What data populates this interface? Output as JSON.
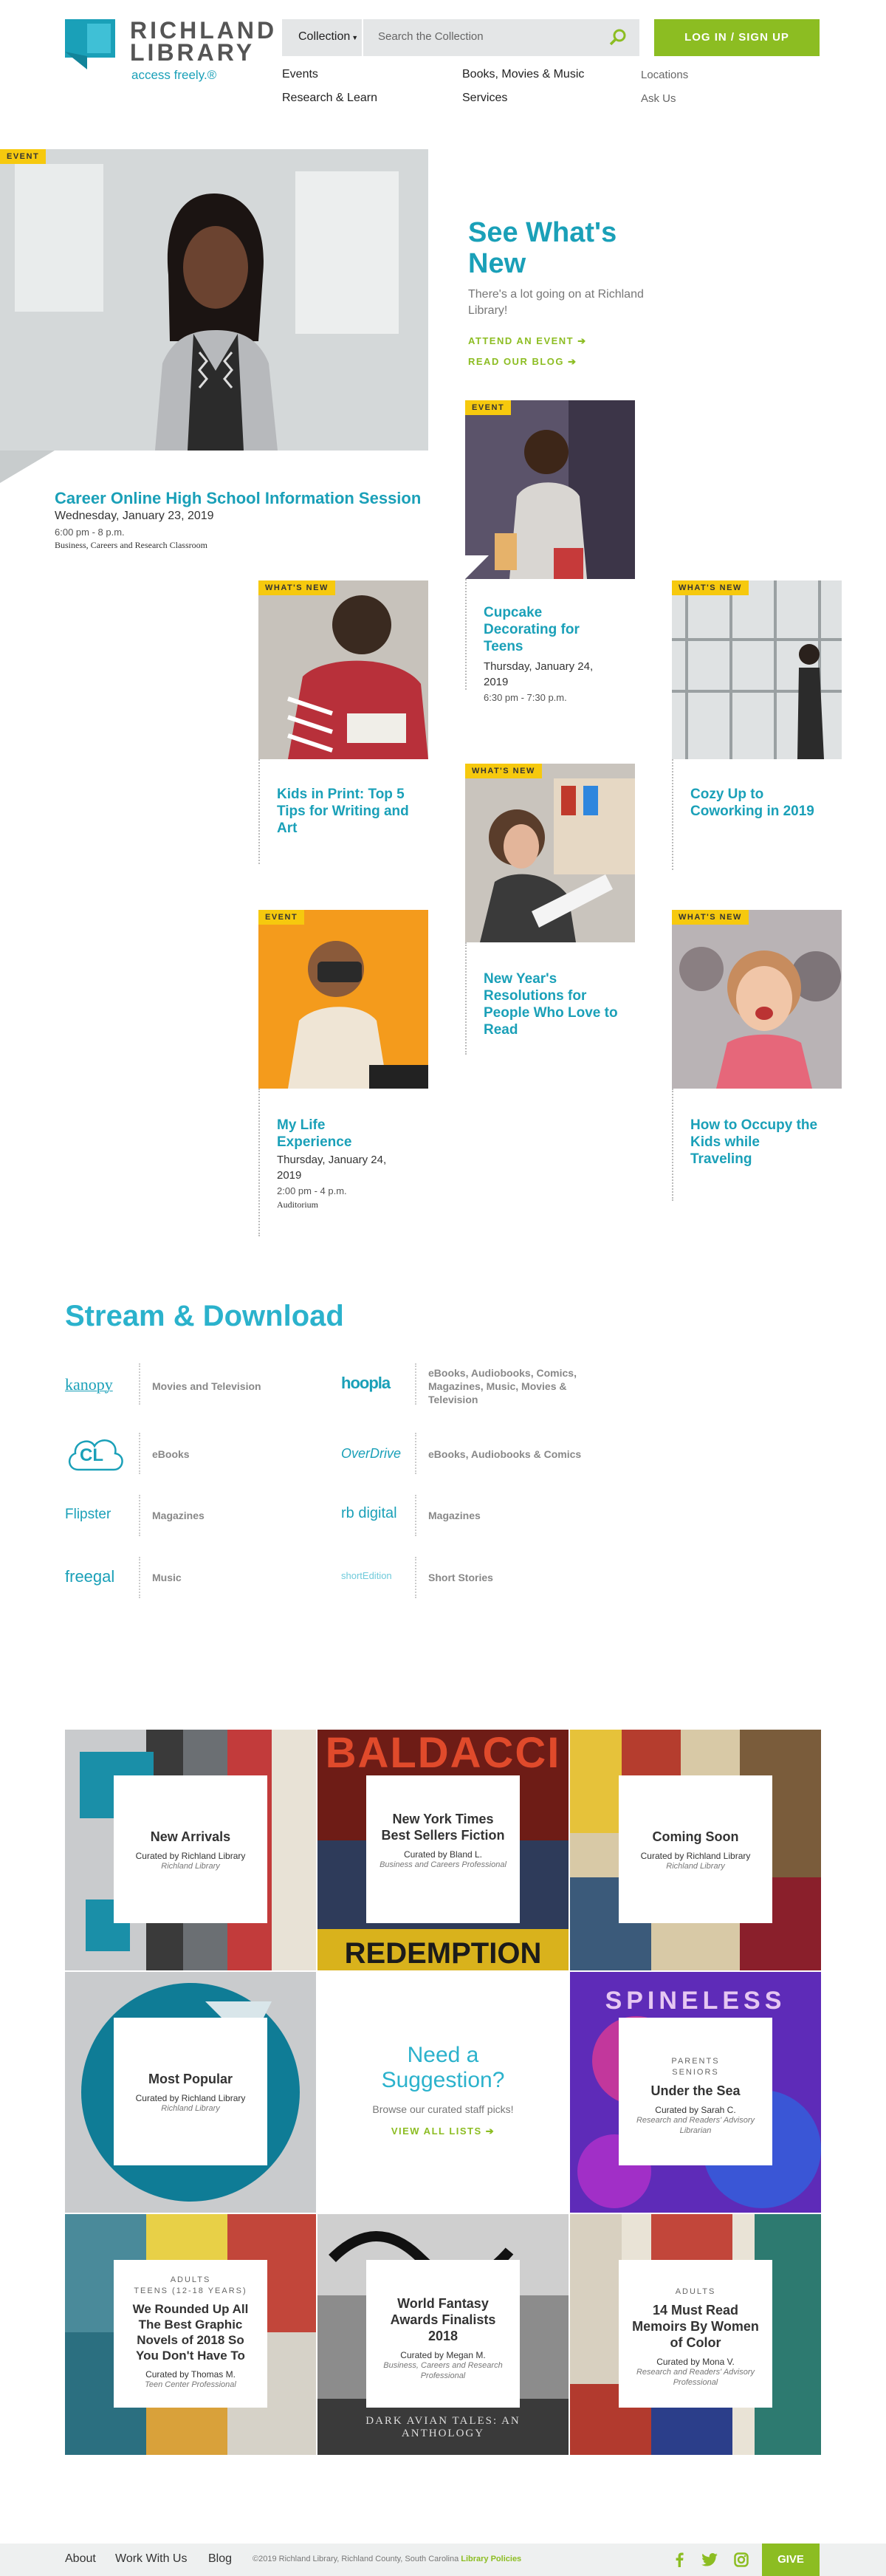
{
  "header": {
    "logo_line1": "RICHLAND",
    "logo_line2": "LIBRARY",
    "tagline": "access freely.®",
    "collection_label": "Collection",
    "search_placeholder": "Search the Collection",
    "login_label": "LOG IN / SIGN UP",
    "nav": [
      "Events",
      "Books, Movies & Music",
      "Locations",
      "Research & Learn",
      "Services",
      "Ask Us"
    ]
  },
  "hero": {
    "tag": "EVENT",
    "title_line1": "See What's",
    "title_line2": "New",
    "text": "There's a lot going on at Richland Library!",
    "cta1": "ATTEND AN EVENT ➔",
    "cta2": "READ OUR BLOG ➔",
    "event_title": "Career Online High School Information Session",
    "event_date": "Wednesday, January 23, 2019",
    "event_time": "6:00 pm - 8 p.m.",
    "event_location": "Business, Careers and Research Classroom"
  },
  "cards": [
    {
      "tag": "EVENT",
      "title": "Cupcake Decorating for Teens",
      "date": "Thursday, January 24, 2019",
      "time": "6:30 pm - 7:30 p.m."
    },
    {
      "tag": "WHAT'S NEW",
      "title": "Kids in Print: Top 5 Tips for Writing and Art"
    },
    {
      "tag": "WHAT'S NEW",
      "title": "Cozy Up to Coworking in 2019"
    },
    {
      "tag": "WHAT'S NEW",
      "title": "New Year's Resolutions for People Who Love to Read"
    },
    {
      "tag": "EVENT",
      "title": "My Life Experience",
      "date": "Thursday, January 24, 2019",
      "time": "2:00 pm - 4 p.m.",
      "location": "Auditorium"
    },
    {
      "tag": "WHAT'S NEW",
      "title": "How to Occupy the Kids while Traveling"
    }
  ],
  "stream": {
    "title": "Stream & Download",
    "services": [
      {
        "logo": "kanopy",
        "text": "Movies and Television"
      },
      {
        "logo": "hoopla",
        "text": "eBooks, Audiobooks, Comics, Magazines, Music, Movies & Television"
      },
      {
        "logo": "CL",
        "text": "eBooks"
      },
      {
        "logo": "OverDrive",
        "text": "eBooks, Audiobooks & Comics"
      },
      {
        "logo": "Flipster",
        "text": "Magazines"
      },
      {
        "logo": "rb digital",
        "text": "Magazines"
      },
      {
        "logo": "freegal",
        "text": "Music"
      },
      {
        "logo": "shortEdition",
        "text": "Short Stories"
      }
    ]
  },
  "lists": [
    {
      "title": "New Arrivals",
      "by": "Curated by Richland Library",
      "who": "Richland Library"
    },
    {
      "title": "New York Times Best Sellers Fiction",
      "by": "Curated by Bland L.",
      "who": "Business and Careers Professional",
      "cover_text": "BALDACCI",
      "cover_text2": "REDEMPTION"
    },
    {
      "title": "Coming Soon",
      "by": "Curated by Richland Library",
      "who": "Richland Library"
    },
    {
      "title": "Most Popular",
      "by": "Curated by Richland Library",
      "who": "Richland Library"
    },
    {
      "title": "Under the Sea",
      "aud1": "PARENTS",
      "aud2": "SENIORS",
      "by": "Curated by Sarah C.",
      "who": "Research and Readers' Advisory Librarian",
      "cover_text": "SPINELESS"
    },
    {
      "title": "We Rounded Up All The Best Graphic Novels of 2018 So You Don't Have To",
      "aud1": "ADULTS",
      "aud2": "TEENS (12-18 YEARS)",
      "by": "Curated by Thomas M.",
      "who": "Teen Center Professional"
    },
    {
      "title": "World Fantasy Awards Finalists 2018",
      "by": "Curated by Megan M.",
      "who": "Business, Careers and Research Professional",
      "cover_text": "DARK AVIAN TALES: AN ANTHOLOGY"
    },
    {
      "title": "14 Must Read Memoirs By Women of Color",
      "aud1": "ADULTS",
      "by": "Curated by Mona V.",
      "who": "Research and Readers' Advisory Professional"
    }
  ],
  "suggestion": {
    "title_line1": "Need a",
    "title_line2": "Suggestion?",
    "text": "Browse our curated staff picks!",
    "cta": "VIEW ALL LISTS ➔"
  },
  "footer": {
    "links": [
      "About",
      "Work With Us",
      "Blog"
    ],
    "copyright": "©2019 Richland Library, Richland County, South Carolina",
    "policies": "Library Policies",
    "give": "GIVE"
  },
  "colors": {
    "teal": "#1aa0b8",
    "green": "#8cbd22",
    "yellow": "#f6c90e"
  }
}
